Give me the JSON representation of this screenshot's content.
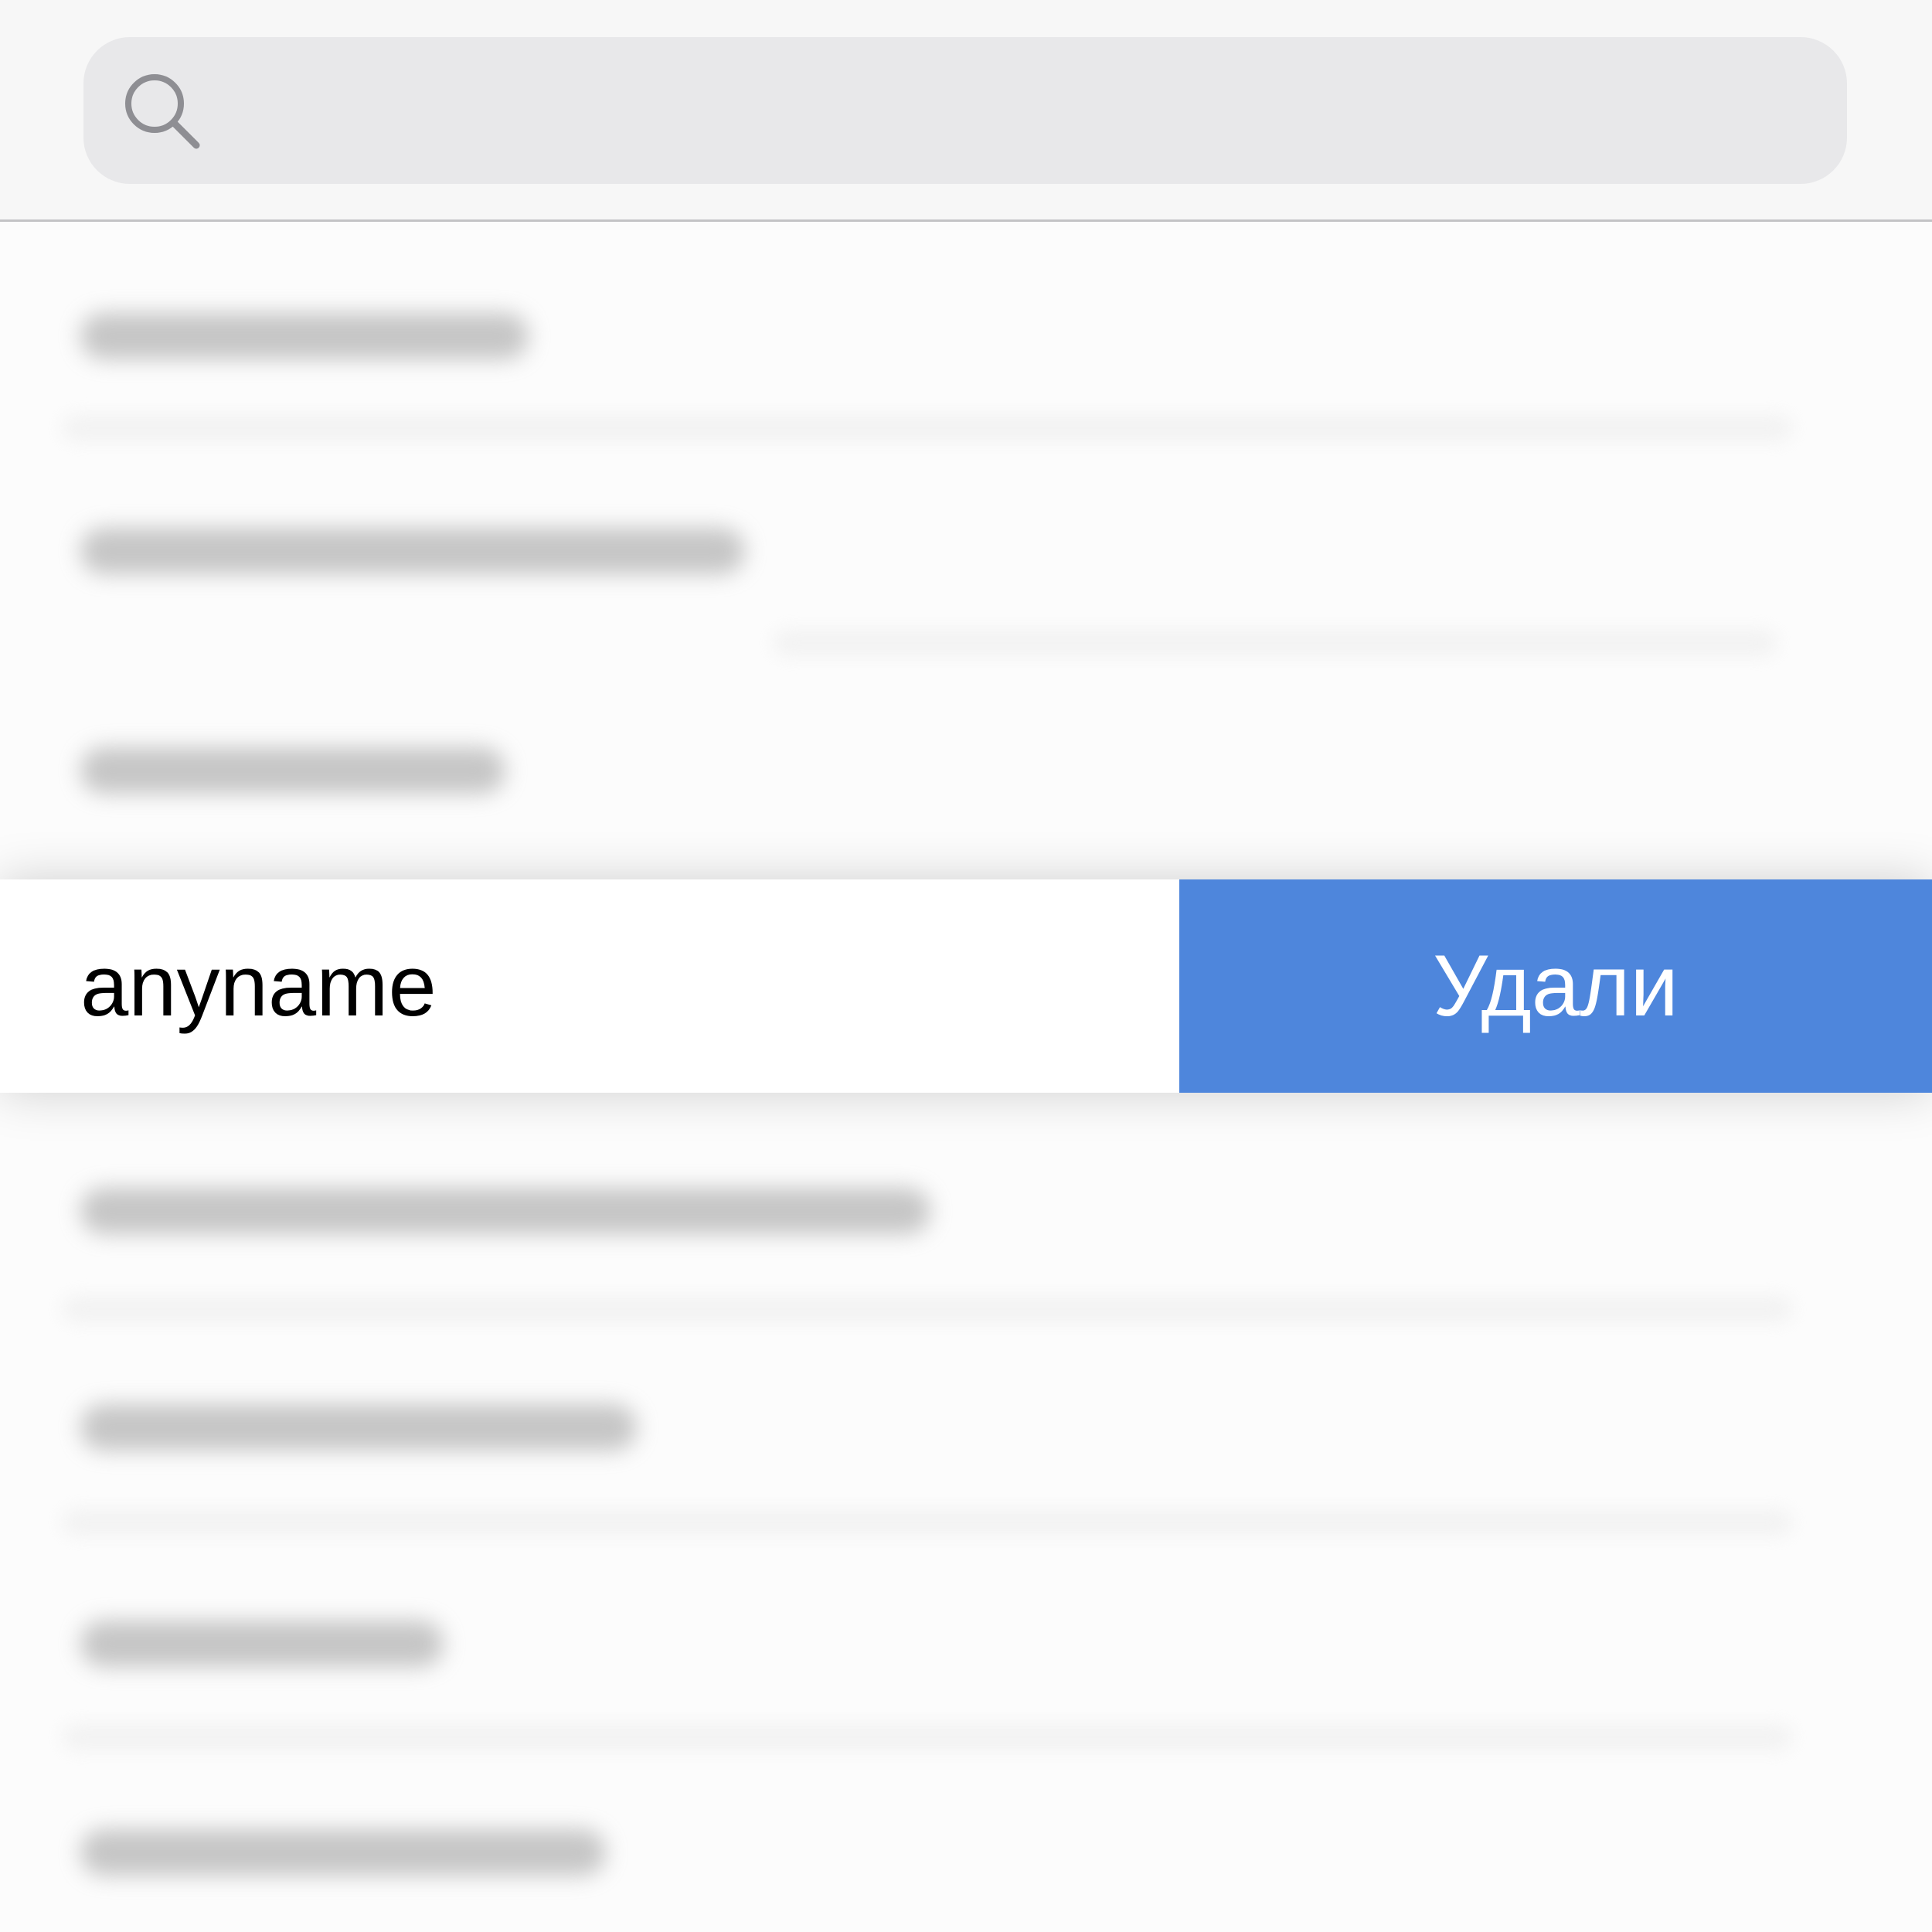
{
  "search": {
    "placeholder": ""
  },
  "swiped_row": {
    "name": "anyname",
    "delete_label": "Удали"
  },
  "colors": {
    "delete_background": "#4e86dc",
    "search_field": "#e8e8ea",
    "header_background": "#f7f7f7"
  }
}
